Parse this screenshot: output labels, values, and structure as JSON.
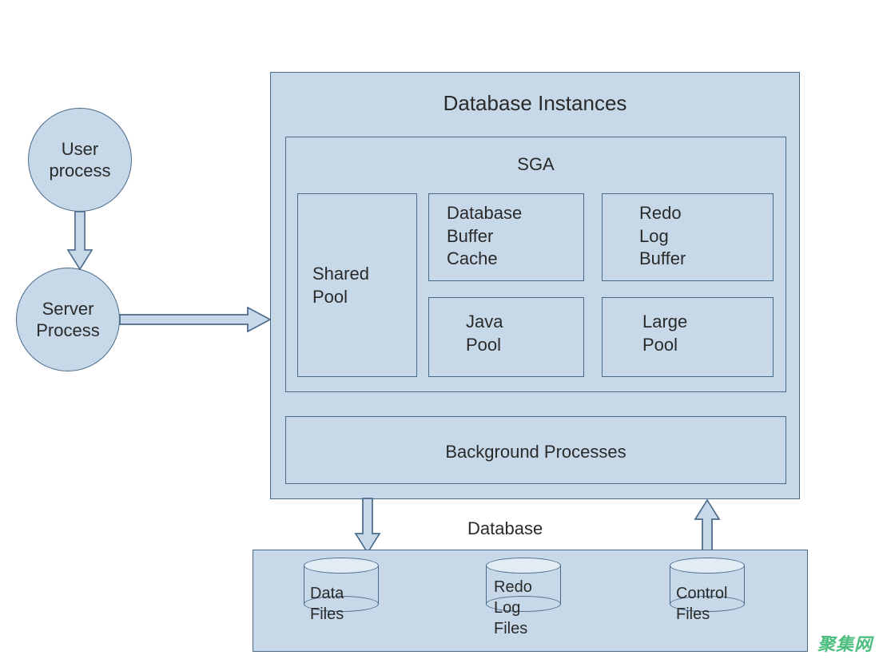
{
  "nodes": {
    "user_process": "User\nprocess",
    "server_process": "Server\nProcess",
    "db_instances_title": "Database Instances",
    "sga_title": "SGA",
    "shared_pool": "Shared\nPool",
    "db_buffer_cache": "Database\nBuffer\nCache",
    "redo_log_buffer": "Redo\nLog\nBuffer",
    "java_pool": "Java\nPool",
    "large_pool": "Large\nPool",
    "background_processes": "Background Processes",
    "database_label": "Database",
    "data_files": "Data\nFiles",
    "redo_log_files": "Redo\nLog\nFiles",
    "control_files": "Control\nFiles"
  },
  "watermark": "聚集网",
  "colors": {
    "fill": "#c7d9e8",
    "stroke": "#4a6a8a",
    "ellipse_top": "#e1ecf4"
  }
}
